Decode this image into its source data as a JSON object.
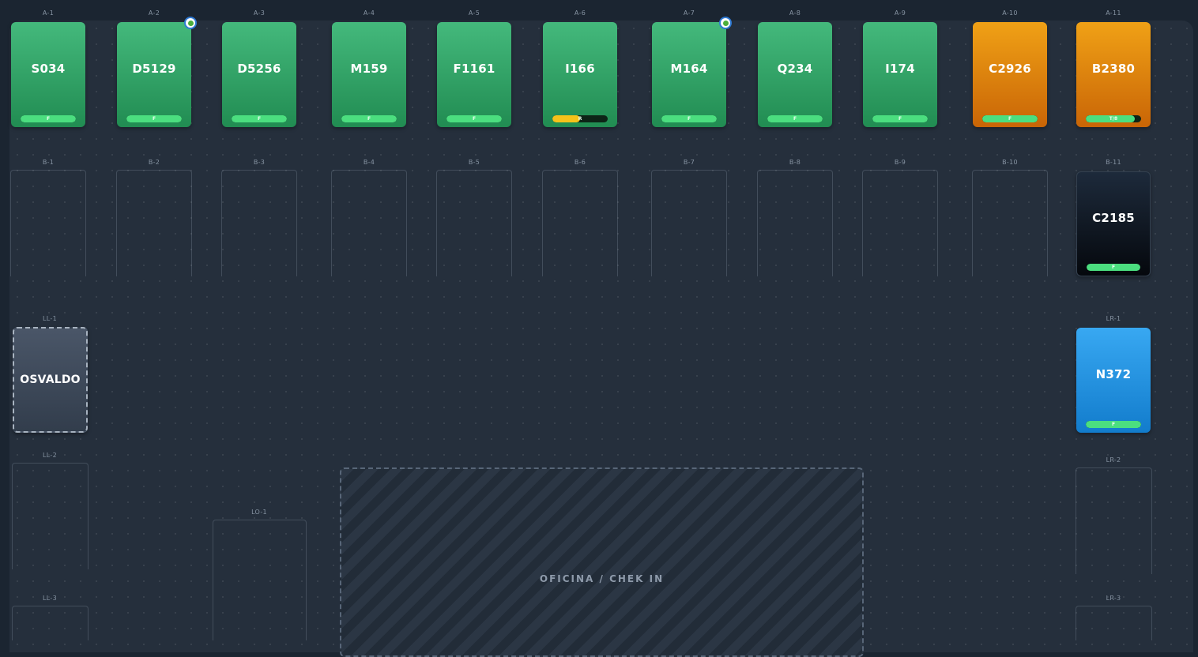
{
  "row_a": {
    "labels": [
      "A-1",
      "A-2",
      "A-3",
      "A-4",
      "A-5",
      "A-6",
      "A-7",
      "A-8",
      "A-9",
      "A-10",
      "A-11"
    ],
    "cards": [
      {
        "code": "S034",
        "color": "green",
        "bar": "F",
        "progress": 1.0,
        "bar_color": "green",
        "badge": false
      },
      {
        "code": "D5129",
        "color": "green",
        "bar": "F",
        "progress": 1.0,
        "bar_color": "green",
        "badge": true
      },
      {
        "code": "D5256",
        "color": "green",
        "bar": "F",
        "progress": 1.0,
        "bar_color": "green",
        "badge": false
      },
      {
        "code": "M159",
        "color": "green",
        "bar": "F",
        "progress": 1.0,
        "bar_color": "green",
        "badge": false
      },
      {
        "code": "F1161",
        "color": "green",
        "bar": "F",
        "progress": 1.0,
        "bar_color": "green",
        "badge": false
      },
      {
        "code": "I166",
        "color": "green",
        "bar": "R",
        "progress": 0.5,
        "bar_color": "yellow",
        "badge": false
      },
      {
        "code": "M164",
        "color": "green",
        "bar": "F",
        "progress": 1.0,
        "bar_color": "green",
        "badge": true
      },
      {
        "code": "Q234",
        "color": "green",
        "bar": "F",
        "progress": 1.0,
        "bar_color": "green",
        "badge": false
      },
      {
        "code": "I174",
        "color": "green",
        "bar": "F",
        "progress": 1.0,
        "bar_color": "green",
        "badge": false
      },
      {
        "code": "C2926",
        "color": "orange",
        "bar": "F",
        "progress": 1.0,
        "bar_color": "green",
        "badge": false
      },
      {
        "code": "B2380",
        "color": "orange",
        "bar": "T/8",
        "progress": 0.88,
        "bar_color": "green",
        "badge": false
      }
    ]
  },
  "row_b": {
    "labels": [
      "B-1",
      "B-2",
      "B-3",
      "B-4",
      "B-5",
      "B-6",
      "B-7",
      "B-8",
      "B-9",
      "B-10",
      "B-11"
    ],
    "card": {
      "slot": "B-11",
      "code": "C2185",
      "color": "dark",
      "bar": "F",
      "progress": 1.0
    }
  },
  "left_lane": {
    "labels": [
      "LL-1",
      "LL-2",
      "LL-3"
    ],
    "driver": "OSVALDO"
  },
  "lo": {
    "label": "LO-1"
  },
  "right_lane": {
    "labels": [
      "LR-1",
      "LR-2",
      "LR-3"
    ],
    "card": {
      "slot": "LR-1",
      "code": "N372",
      "color": "blue",
      "bar": "F",
      "progress": 1.0
    }
  },
  "office": {
    "label": "OFICINA / CHEK IN"
  },
  "colors": {
    "green_card": "#2fa565",
    "orange_card": "#e38b0e",
    "blue_card": "#259bea",
    "dark_card": "#0d141e",
    "bar_green": "#4bde7f",
    "bar_yellow": "#f4c21a"
  }
}
